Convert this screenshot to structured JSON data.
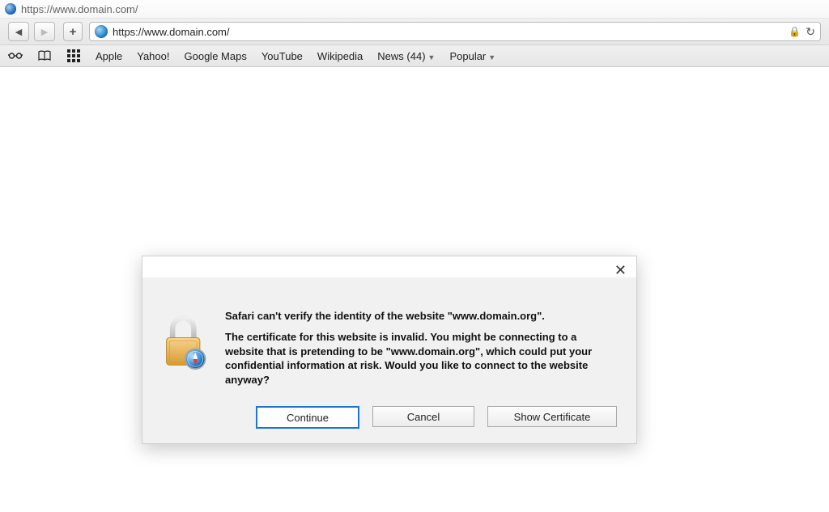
{
  "window": {
    "title": "https://www.domain.com/"
  },
  "toolbar": {
    "url": "https://www.domain.com/",
    "back_enabled": true,
    "forward_enabled": false
  },
  "bookmarks": [
    {
      "label": "Apple",
      "has_menu": false
    },
    {
      "label": "Yahoo!",
      "has_menu": false
    },
    {
      "label": "Google Maps",
      "has_menu": false
    },
    {
      "label": "YouTube",
      "has_menu": false
    },
    {
      "label": "Wikipedia",
      "has_menu": false
    },
    {
      "label": "News (44)",
      "has_menu": true
    },
    {
      "label": "Popular",
      "has_menu": true
    }
  ],
  "dialog": {
    "title": "Safari can't verify the identity of the website \"www.domain.org\".",
    "message": "The certificate for this website is invalid. You might be connecting to a website that is pretending to be \"www.domain.org\", which could put your confidential information at risk. Would you like to connect to the website anyway?",
    "buttons": {
      "continue": "Continue",
      "cancel": "Cancel",
      "show_cert": "Show Certificate"
    }
  }
}
